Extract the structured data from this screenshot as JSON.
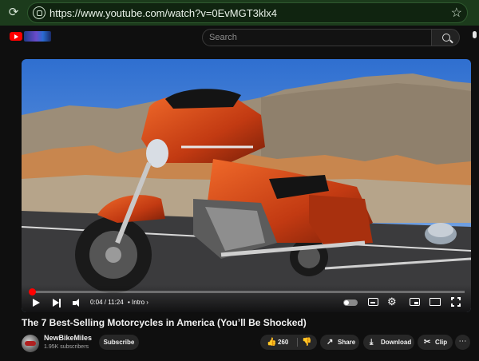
{
  "browser": {
    "url": "https://www.youtube.com/watch?v=0EvMGT3klx4",
    "reload_icon": "reload-icon",
    "lock_icon": "site-info-icon",
    "bookmark_icon": "star-icon"
  },
  "header": {
    "logo_icon": "youtube-logo-icon",
    "doodle": "doodle-banner",
    "search": {
      "placeholder": "Search"
    },
    "search_icon": "search-icon",
    "mic_icon": "microphone-icon"
  },
  "player": {
    "time": "0:04 / 11:24",
    "chapter": "• Intro ›",
    "progress": 0.006,
    "controls": [
      "play-icon",
      "next-icon",
      "volume-icon",
      "autoplay-toggle",
      "captions-icon",
      "settings-icon",
      "miniplayer-icon",
      "theater-icon",
      "fullscreen-icon"
    ]
  },
  "video": {
    "title": "The 7 Best-Selling Motorcycles in America (You’ll Be Shocked)"
  },
  "channel": {
    "name": "NewBikeMiles",
    "subscribers": "1.95K subscribers",
    "subscribe_label": "Subscribe"
  },
  "actions": {
    "likes": "260",
    "share_label": "Share",
    "download_label": "Download",
    "clip_label": "Clip",
    "more_label": "⋯"
  }
}
